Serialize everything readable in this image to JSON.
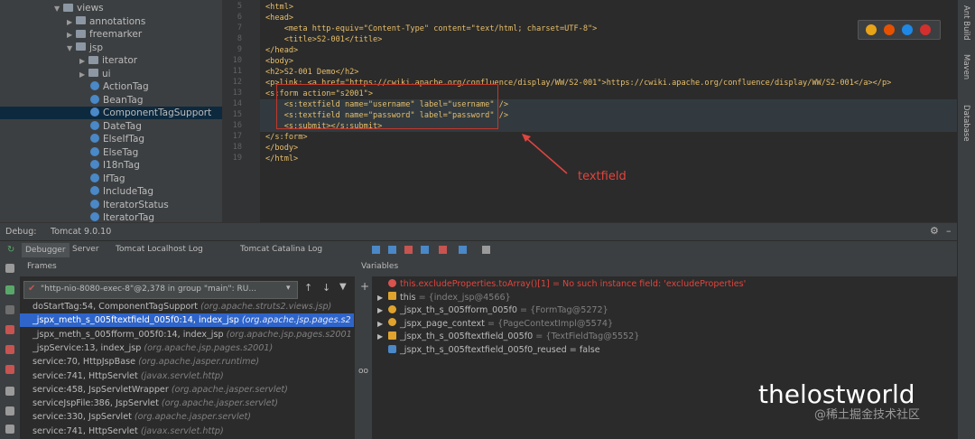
{
  "tree": [
    {
      "label": "views",
      "kind": "folder",
      "open": true
    },
    {
      "label": "annotations",
      "kind": "folder",
      "open": false
    },
    {
      "label": "freemarker",
      "kind": "folder",
      "open": false
    },
    {
      "label": "jsp",
      "kind": "folder",
      "open": true
    },
    {
      "label": "iterator",
      "kind": "folder",
      "open": false
    },
    {
      "label": "ui",
      "kind": "folder",
      "open": false
    },
    {
      "label": "ActionTag",
      "kind": "class"
    },
    {
      "label": "BeanTag",
      "kind": "class"
    },
    {
      "label": "ComponentTagSupport",
      "kind": "class",
      "selected": true
    },
    {
      "label": "DateTag",
      "kind": "class"
    },
    {
      "label": "ElseIfTag",
      "kind": "class"
    },
    {
      "label": "ElseTag",
      "kind": "class"
    },
    {
      "label": "I18nTag",
      "kind": "class"
    },
    {
      "label": "IfTag",
      "kind": "class"
    },
    {
      "label": "IncludeTag",
      "kind": "class"
    },
    {
      "label": "IteratorStatus",
      "kind": "class"
    },
    {
      "label": "IteratorTag",
      "kind": "class"
    }
  ],
  "editor": {
    "line_numbers": [
      "5",
      "6",
      "7",
      "8",
      "9",
      "10",
      "11",
      "12",
      "13",
      "14",
      "15",
      "16",
      "17",
      "18",
      "19"
    ],
    "lines": [
      "<html>",
      "<head>",
      "    <meta http-equiv=\"Content-Type\" content=\"text/html; charset=UTF-8\">",
      "    <title>S2-001</title>",
      "</head>",
      "<body>",
      "<h2>S2-001 Demo</h2>",
      "<p>link: <a href=\"https://cwiki.apache.org/confluence/display/WW/S2-001\">https://cwiki.apache.org/confluence/display/WW/S2-001</a></p>",
      "<s:form action=\"s2001\">",
      "    <s:textfield name=\"username\" label=\"username\" />",
      "    <s:textfield name=\"password\" label=\"password\" />",
      "    <s:submit></s:submit>",
      "</s:form>",
      "</body>",
      "</html>"
    ],
    "annotation": "textfield"
  },
  "right_strip": {
    "items": [
      "Ant Build",
      "Maven",
      "Database"
    ]
  },
  "debug": {
    "label": "Debug:",
    "config": "Tomcat 9.0.10",
    "tabs": [
      "Debugger",
      "Server",
      "Tomcat Localhost Log",
      "Tomcat Catalina Log"
    ],
    "frames_title": "Frames",
    "variables_title": "Variables",
    "thread": "\"http-nio-8080-exec-8\"@2,378 in group \"main\": RU...",
    "frames": [
      {
        "method": "doStartTag:54, ComponentTagSupport",
        "pkg": "(org.apache.struts2.views.jsp)"
      },
      {
        "method": "_jspx_meth_s_005ftextfield_005f0:14, index_jsp",
        "pkg": "(org.apache.jsp.pages.s2",
        "selected": true
      },
      {
        "method": "_jspx_meth_s_005fform_005f0:14, index_jsp",
        "pkg": "(org.apache.jsp.pages.s2001"
      },
      {
        "method": "_jspService:13, index_jsp",
        "pkg": "(org.apache.jsp.pages.s2001)"
      },
      {
        "method": "service:70, HttpJspBase",
        "pkg": "(org.apache.jasper.runtime)"
      },
      {
        "method": "service:741, HttpServlet",
        "pkg": "(javax.servlet.http)"
      },
      {
        "method": "service:458, JspServletWrapper",
        "pkg": "(org.apache.jasper.servlet)"
      },
      {
        "method": "serviceJspFile:386, JspServlet",
        "pkg": "(org.apache.jasper.servlet)"
      },
      {
        "method": "service:330, JspServlet",
        "pkg": "(org.apache.jasper.servlet)"
      },
      {
        "method": "service:741, HttpServlet",
        "pkg": "(javax.servlet.http)"
      }
    ],
    "variables": [
      {
        "name": "this.excludeProperties.toArray()[1]",
        "value": " = No such instance field: 'excludeProperties'",
        "icon": "error",
        "expand": false
      },
      {
        "name": "this",
        "value": " = {index_jsp@4566}",
        "icon": "list",
        "expand": true
      },
      {
        "name": "_jspx_th_s_005fform_005f0",
        "value": " = {FormTag@5272}",
        "icon": "field",
        "expand": true
      },
      {
        "name": "_jspx_page_context",
        "value": " = {PageContextImpl@5574}",
        "icon": "field",
        "expand": true
      },
      {
        "name": "_jspx_th_s_005ftextfield_005f0",
        "value": " = {TextFieldTag@5552}",
        "icon": "list",
        "expand": true
      },
      {
        "name": "_jspx_th_s_005ftextfield_005f0_reused",
        "value": " = false",
        "icon": "bool",
        "expand": false
      }
    ]
  },
  "watermark": {
    "logo": "thelostworld",
    "sub": "@稀土掘金技术社区"
  }
}
